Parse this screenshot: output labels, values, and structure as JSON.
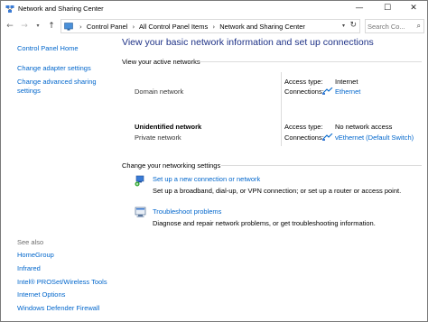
{
  "window": {
    "title": "Network and Sharing Center",
    "min_label": "—",
    "max_label": "☐",
    "close_label": "✕"
  },
  "nav": {
    "back_icon": "←",
    "forward_icon": "→",
    "recent_icon": "▾",
    "up_icon": "↑",
    "breadcrumbs": [
      "Control Panel",
      "All Control Panel Items",
      "Network and Sharing Center"
    ],
    "separator": "›",
    "dropdown_icon": "▾",
    "refresh_icon": "↻",
    "search_placeholder": "Search Co...",
    "search_icon": "⌕"
  },
  "sidebar": {
    "home": "Control Panel Home",
    "items": [
      "Change adapter settings",
      "Change advanced sharing settings"
    ],
    "see_also_label": "See also",
    "see_also": [
      "HomeGroup",
      "Infrared",
      "Intel® PROSet/Wireless Tools",
      "Internet Options",
      "Windows Defender Firewall"
    ]
  },
  "main": {
    "heading": "View your basic network information and set up connections",
    "active_networks_label": "View your active networks",
    "networks": [
      {
        "name": "",
        "category": "Domain network",
        "access_type_label": "Access type:",
        "access_type": "Internet",
        "connections_label": "Connections:",
        "connection": "Ethernet"
      },
      {
        "name": "Unidentified network",
        "category": "Private network",
        "access_type_label": "Access type:",
        "access_type": "No network access",
        "connections_label": "Connections:",
        "connection": "vEthernet (Default Switch)"
      }
    ],
    "change_settings_label": "Change your networking settings",
    "tasks": [
      {
        "icon": "network-setup-icon",
        "title": "Set up a new connection or network",
        "description": "Set up a broadband, dial-up, or VPN connection; or set up a router or access point."
      },
      {
        "icon": "troubleshoot-icon",
        "title": "Troubleshoot problems",
        "description": "Diagnose and repair network problems, or get troubleshooting information."
      }
    ]
  },
  "colors": {
    "link": "#0066cc",
    "heading": "#1e3287"
  }
}
